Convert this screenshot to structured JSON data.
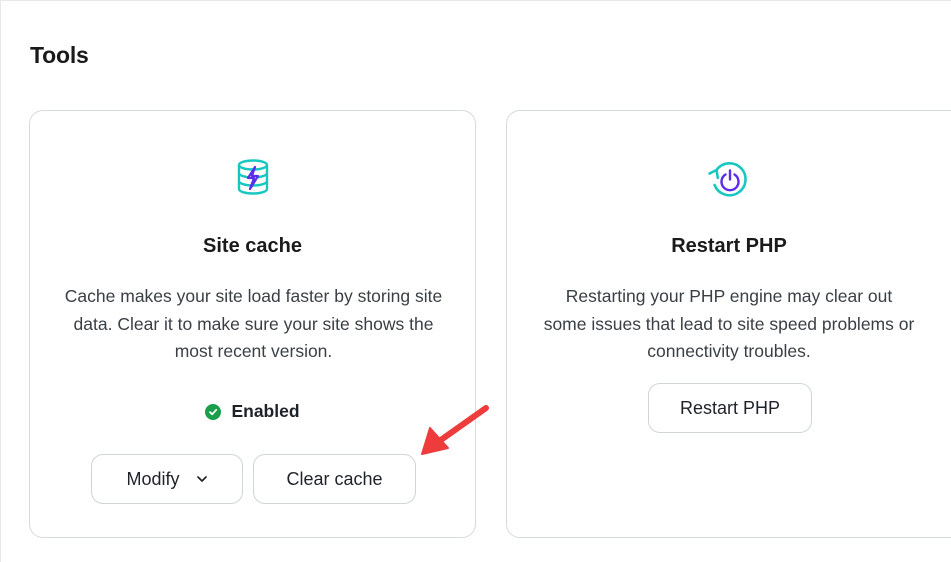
{
  "section": {
    "title": "Tools"
  },
  "site_cache": {
    "icon": "database-bolt-icon",
    "title": "Site cache",
    "description": "Cache makes your site load faster by storing site data. Clear it to make sure your site shows the most recent version.",
    "status_label": "Enabled",
    "status_icon": "check-circle-icon",
    "modify_label": "Modify",
    "clear_label": "Clear cache"
  },
  "restart_php": {
    "icon": "power-restart-icon",
    "title": "Restart PHP",
    "description": "Restarting your PHP engine may clear out some issues that lead to site speed problems or connectivity troubles.",
    "button_label": "Restart PHP"
  },
  "colors": {
    "icon_teal": "#19c7c1",
    "icon_purple": "#5b2de8",
    "status_green": "#1a9e4b",
    "annotation_red": "#ee3b3b"
  }
}
